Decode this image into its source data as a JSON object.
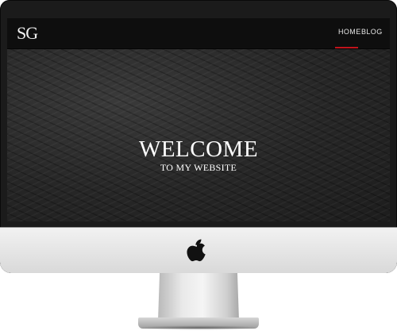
{
  "site": {
    "brand_logo": "SG",
    "nav": {
      "items": [
        {
          "label": "HOME",
          "active": true
        },
        {
          "label": "BLOG",
          "active": false
        }
      ],
      "active_color": "#c0131b"
    },
    "hero": {
      "title": "WELCOME",
      "subtitle": "TO MY WEBSITE"
    }
  },
  "device": {
    "logo_icon": "apple-logo-icon"
  }
}
